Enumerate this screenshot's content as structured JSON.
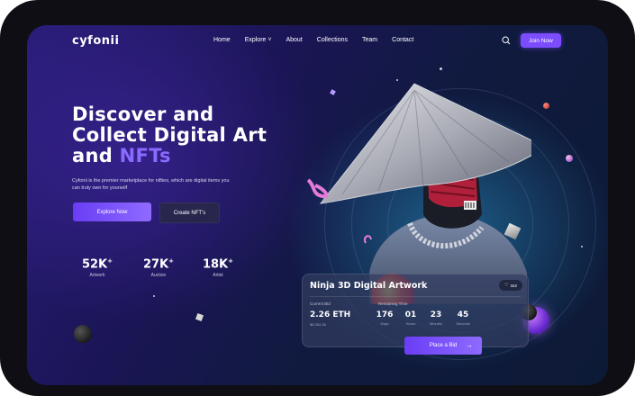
{
  "header": {
    "logo": "cyfonii",
    "nav": [
      "Home",
      "Explore ˅",
      "About",
      "Collections",
      "Team",
      "Contact"
    ],
    "join_label": "Join Now"
  },
  "hero": {
    "title_line1": "Discover and",
    "title_line2": "Collect Digital Art",
    "title_line3_prefix": "and ",
    "title_line3_accent": "NFTs",
    "description": "Cyfonii is the premier marketplace for nifties, which are digital items you can truly own for yourself",
    "explore_label": "Explore Now",
    "create_label": "Create NFT's"
  },
  "stats": [
    {
      "value": "52K",
      "suffix": "+",
      "label": "Artwork"
    },
    {
      "value": "27K",
      "suffix": "+",
      "label": "Auction"
    },
    {
      "value": "18K",
      "suffix": "+",
      "label": "Artist"
    }
  ],
  "card": {
    "title": "Ninja 3D Digital Artwork",
    "likes": "342",
    "current_bid_label": "Current Bid",
    "current_bid_value": "2.26 ETH",
    "current_bid_usd": "$8,354.36",
    "remaining_label": "Remaining Time",
    "timer": [
      {
        "num": "176",
        "unit": "Days"
      },
      {
        "num": "01",
        "unit": "Hours"
      },
      {
        "num": "23",
        "unit": "Minutes"
      },
      {
        "num": "45",
        "unit": "Seconds"
      }
    ],
    "bid_label": "Place a Bid"
  },
  "icons": {
    "search": "search-icon",
    "heart": "heart-icon",
    "arrow": "arrow-right-icon"
  },
  "colors": {
    "accent": "#7b4dff",
    "accent_text": "#8b6bff",
    "background_dark": "#1a1555"
  }
}
